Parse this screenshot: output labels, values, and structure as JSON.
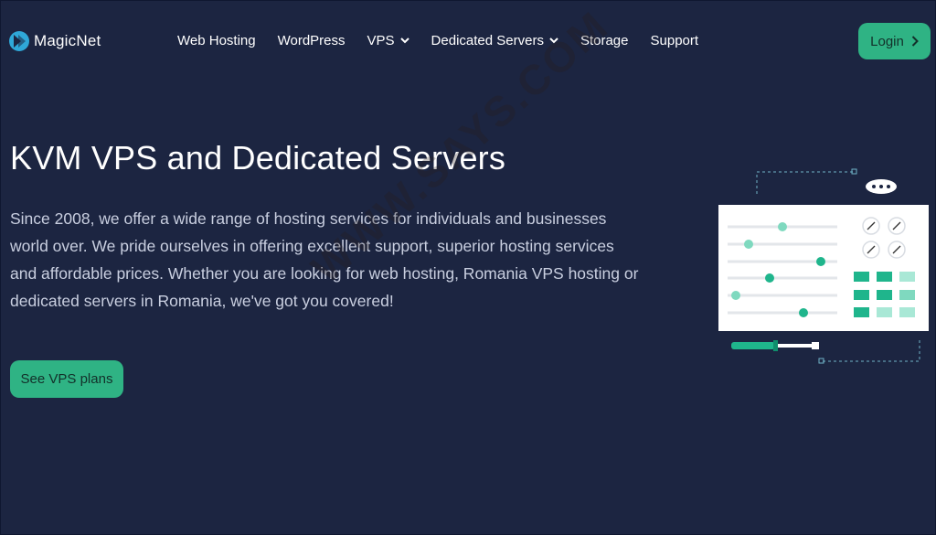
{
  "brand": {
    "name": "MagicNet",
    "icon": "magicnet-logo-icon"
  },
  "nav": {
    "items": [
      {
        "label": "Web Hosting",
        "dropdown": false
      },
      {
        "label": "WordPress",
        "dropdown": false
      },
      {
        "label": "VPS",
        "dropdown": true
      },
      {
        "label": "Dedicated Servers",
        "dropdown": true
      },
      {
        "label": "Storage",
        "dropdown": false
      },
      {
        "label": "Support",
        "dropdown": false
      }
    ],
    "login_label": "Login"
  },
  "hero": {
    "title": "KVM VPS and Dedicated Servers",
    "text": "Since 2008, we offer a wide range of hosting services for individuals and businesses world over. We pride ourselves in offering excellent support, superior hosting services and affordable prices. Whether you are looking for web hosting, Romania VPS hosting or dedicated servers in Romania, we've got you covered!",
    "cta_label": "See VPS plans"
  },
  "watermark": "WWW.SAYS.COM",
  "colors": {
    "background": "#1c2541",
    "accent": "#2fb384",
    "accent_light": "#7fd9bf",
    "text_muted": "#c9cfe0"
  }
}
